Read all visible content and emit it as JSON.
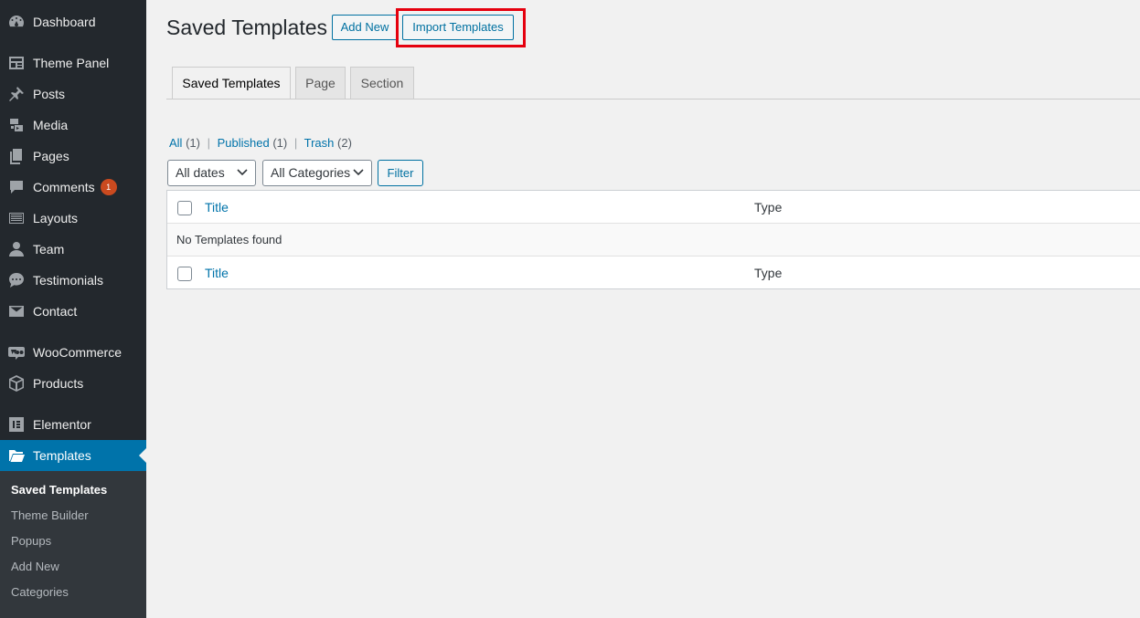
{
  "sidebar": {
    "items": [
      {
        "label": "Dashboard",
        "icon": "dashboard-icon"
      },
      {
        "label": "Theme Panel",
        "icon": "theme-panel-icon"
      },
      {
        "label": "Posts",
        "icon": "pushpin-icon"
      },
      {
        "label": "Media",
        "icon": "media-icon"
      },
      {
        "label": "Pages",
        "icon": "pages-icon"
      },
      {
        "label": "Comments",
        "icon": "comments-icon",
        "badge": "1"
      },
      {
        "label": "Layouts",
        "icon": "layouts-icon"
      },
      {
        "label": "Team",
        "icon": "team-icon"
      },
      {
        "label": "Testimonials",
        "icon": "testimonials-icon"
      },
      {
        "label": "Contact",
        "icon": "envelope-icon"
      },
      {
        "label": "WooCommerce",
        "icon": "woocommerce-icon"
      },
      {
        "label": "Products",
        "icon": "products-icon"
      },
      {
        "label": "Elementor",
        "icon": "elementor-icon"
      },
      {
        "label": "Templates",
        "icon": "folder-open-icon",
        "current": true
      }
    ],
    "submenu": [
      {
        "label": "Saved Templates",
        "current": true
      },
      {
        "label": "Theme Builder"
      },
      {
        "label": "Popups"
      },
      {
        "label": "Add New"
      },
      {
        "label": "Categories"
      }
    ]
  },
  "header": {
    "title": "Saved Templates",
    "add_new_label": "Add New",
    "import_label": "Import Templates"
  },
  "tabs": [
    {
      "label": "Saved Templates",
      "active": true
    },
    {
      "label": "Page"
    },
    {
      "label": "Section"
    }
  ],
  "status_links": {
    "all": "All",
    "all_count": "(1)",
    "published": "Published",
    "published_count": "(1)",
    "trash": "Trash",
    "trash_count": "(2)",
    "separator": "|"
  },
  "filters": {
    "dates_value": "All dates",
    "categories_value": "All Categories",
    "filter_label": "Filter"
  },
  "table": {
    "columns": {
      "title": "Title",
      "type": "Type"
    },
    "empty_message": "No Templates found"
  },
  "colors": {
    "sidebar_bg": "#23282d",
    "accent": "#0073aa",
    "highlight": "#e5000e",
    "badge": "#ca4a1f"
  }
}
